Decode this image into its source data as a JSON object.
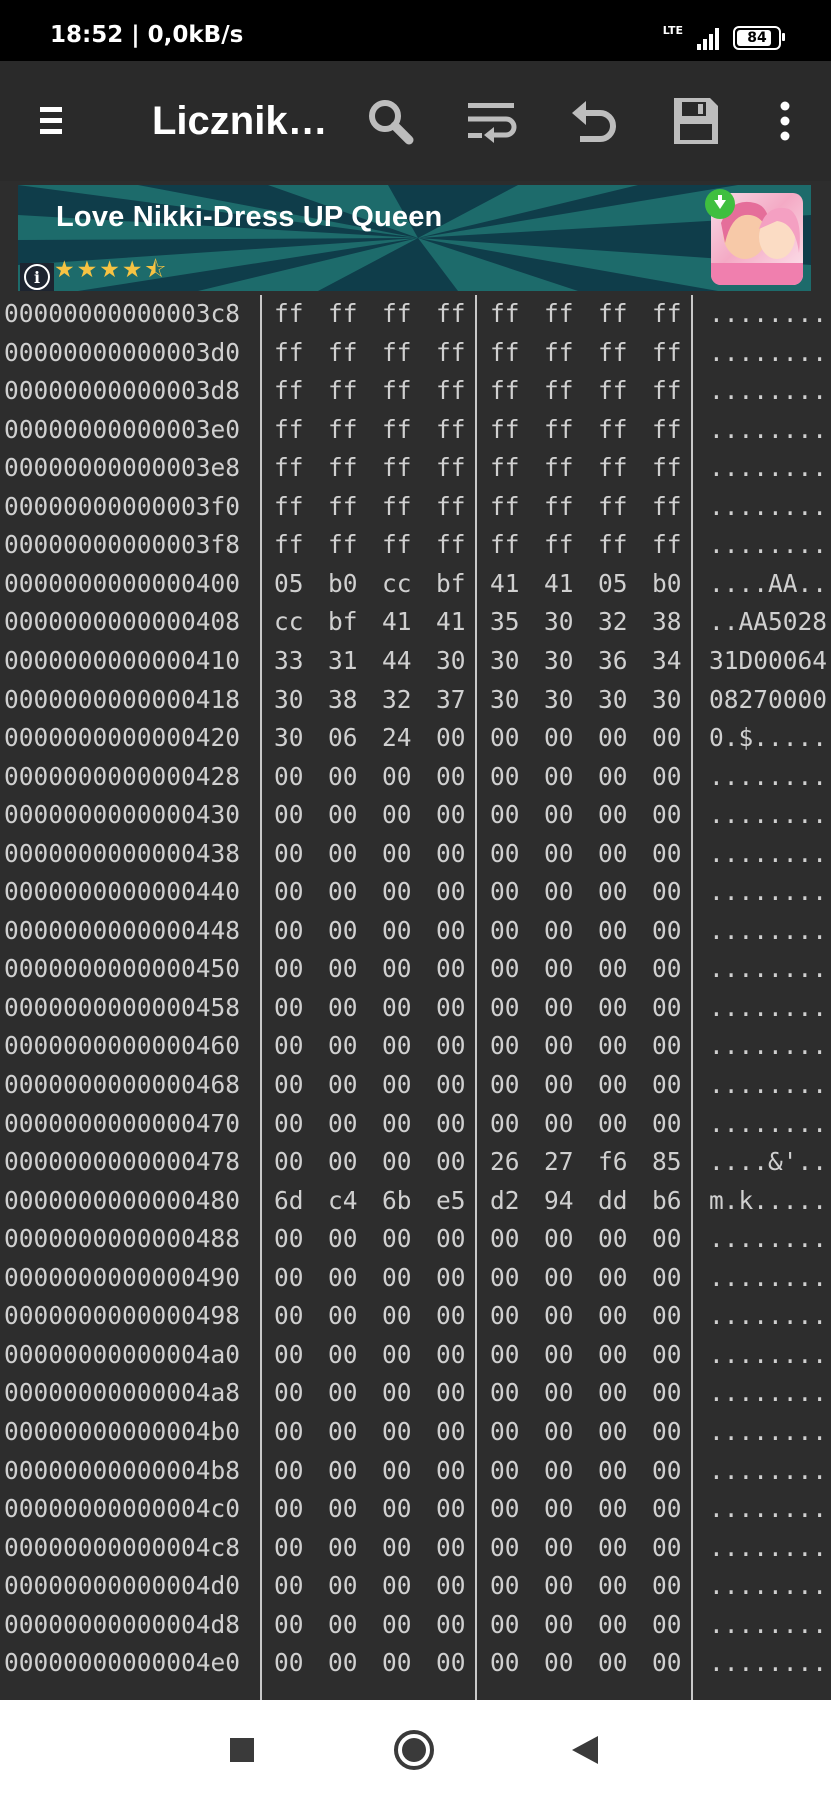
{
  "status_bar": {
    "time_speed": "18:52 | 0,0kB/s",
    "network": "LTE",
    "battery": "84",
    "battery_fraction": 0.84
  },
  "toolbar": {
    "title": "Licznik…",
    "icons": [
      "menu-icon",
      "search-icon",
      "wrap-icon",
      "undo-icon",
      "save-icon",
      "more-vert-icon"
    ]
  },
  "ad": {
    "title": "Love Nikki-Dress UP Queen",
    "stars": "★★★★⯪",
    "rating": 4.5,
    "info_icon": "i"
  },
  "hex_rows": [
    {
      "addr": "00000000000003c8",
      "bytes": [
        "ff",
        "ff",
        "ff",
        "ff",
        "ff",
        "ff",
        "ff",
        "ff"
      ],
      "ascii": "........"
    },
    {
      "addr": "00000000000003d0",
      "bytes": [
        "ff",
        "ff",
        "ff",
        "ff",
        "ff",
        "ff",
        "ff",
        "ff"
      ],
      "ascii": "........"
    },
    {
      "addr": "00000000000003d8",
      "bytes": [
        "ff",
        "ff",
        "ff",
        "ff",
        "ff",
        "ff",
        "ff",
        "ff"
      ],
      "ascii": "........"
    },
    {
      "addr": "00000000000003e0",
      "bytes": [
        "ff",
        "ff",
        "ff",
        "ff",
        "ff",
        "ff",
        "ff",
        "ff"
      ],
      "ascii": "........"
    },
    {
      "addr": "00000000000003e8",
      "bytes": [
        "ff",
        "ff",
        "ff",
        "ff",
        "ff",
        "ff",
        "ff",
        "ff"
      ],
      "ascii": "........"
    },
    {
      "addr": "00000000000003f0",
      "bytes": [
        "ff",
        "ff",
        "ff",
        "ff",
        "ff",
        "ff",
        "ff",
        "ff"
      ],
      "ascii": "........"
    },
    {
      "addr": "00000000000003f8",
      "bytes": [
        "ff",
        "ff",
        "ff",
        "ff",
        "ff",
        "ff",
        "ff",
        "ff"
      ],
      "ascii": "........"
    },
    {
      "addr": "0000000000000400",
      "bytes": [
        "05",
        "b0",
        "cc",
        "bf",
        "41",
        "41",
        "05",
        "b0"
      ],
      "ascii": "....AA.."
    },
    {
      "addr": "0000000000000408",
      "bytes": [
        "cc",
        "bf",
        "41",
        "41",
        "35",
        "30",
        "32",
        "38"
      ],
      "ascii": "..AA5028"
    },
    {
      "addr": "0000000000000410",
      "bytes": [
        "33",
        "31",
        "44",
        "30",
        "30",
        "30",
        "36",
        "34"
      ],
      "ascii": "31D00064"
    },
    {
      "addr": "0000000000000418",
      "bytes": [
        "30",
        "38",
        "32",
        "37",
        "30",
        "30",
        "30",
        "30"
      ],
      "ascii": "08270000"
    },
    {
      "addr": "0000000000000420",
      "bytes": [
        "30",
        "06",
        "24",
        "00",
        "00",
        "00",
        "00",
        "00"
      ],
      "ascii": "0.$....."
    },
    {
      "addr": "0000000000000428",
      "bytes": [
        "00",
        "00",
        "00",
        "00",
        "00",
        "00",
        "00",
        "00"
      ],
      "ascii": "........"
    },
    {
      "addr": "0000000000000430",
      "bytes": [
        "00",
        "00",
        "00",
        "00",
        "00",
        "00",
        "00",
        "00"
      ],
      "ascii": "........"
    },
    {
      "addr": "0000000000000438",
      "bytes": [
        "00",
        "00",
        "00",
        "00",
        "00",
        "00",
        "00",
        "00"
      ],
      "ascii": "........"
    },
    {
      "addr": "0000000000000440",
      "bytes": [
        "00",
        "00",
        "00",
        "00",
        "00",
        "00",
        "00",
        "00"
      ],
      "ascii": "........"
    },
    {
      "addr": "0000000000000448",
      "bytes": [
        "00",
        "00",
        "00",
        "00",
        "00",
        "00",
        "00",
        "00"
      ],
      "ascii": "........"
    },
    {
      "addr": "0000000000000450",
      "bytes": [
        "00",
        "00",
        "00",
        "00",
        "00",
        "00",
        "00",
        "00"
      ],
      "ascii": "........"
    },
    {
      "addr": "0000000000000458",
      "bytes": [
        "00",
        "00",
        "00",
        "00",
        "00",
        "00",
        "00",
        "00"
      ],
      "ascii": "........"
    },
    {
      "addr": "0000000000000460",
      "bytes": [
        "00",
        "00",
        "00",
        "00",
        "00",
        "00",
        "00",
        "00"
      ],
      "ascii": "........"
    },
    {
      "addr": "0000000000000468",
      "bytes": [
        "00",
        "00",
        "00",
        "00",
        "00",
        "00",
        "00",
        "00"
      ],
      "ascii": "........"
    },
    {
      "addr": "0000000000000470",
      "bytes": [
        "00",
        "00",
        "00",
        "00",
        "00",
        "00",
        "00",
        "00"
      ],
      "ascii": "........"
    },
    {
      "addr": "0000000000000478",
      "bytes": [
        "00",
        "00",
        "00",
        "00",
        "26",
        "27",
        "f6",
        "85"
      ],
      "ascii": "....&'.."
    },
    {
      "addr": "0000000000000480",
      "bytes": [
        "6d",
        "c4",
        "6b",
        "e5",
        "d2",
        "94",
        "dd",
        "b6"
      ],
      "ascii": "m.k....."
    },
    {
      "addr": "0000000000000488",
      "bytes": [
        "00",
        "00",
        "00",
        "00",
        "00",
        "00",
        "00",
        "00"
      ],
      "ascii": "........"
    },
    {
      "addr": "0000000000000490",
      "bytes": [
        "00",
        "00",
        "00",
        "00",
        "00",
        "00",
        "00",
        "00"
      ],
      "ascii": "........"
    },
    {
      "addr": "0000000000000498",
      "bytes": [
        "00",
        "00",
        "00",
        "00",
        "00",
        "00",
        "00",
        "00"
      ],
      "ascii": "........"
    },
    {
      "addr": "00000000000004a0",
      "bytes": [
        "00",
        "00",
        "00",
        "00",
        "00",
        "00",
        "00",
        "00"
      ],
      "ascii": "........"
    },
    {
      "addr": "00000000000004a8",
      "bytes": [
        "00",
        "00",
        "00",
        "00",
        "00",
        "00",
        "00",
        "00"
      ],
      "ascii": "........"
    },
    {
      "addr": "00000000000004b0",
      "bytes": [
        "00",
        "00",
        "00",
        "00",
        "00",
        "00",
        "00",
        "00"
      ],
      "ascii": "........"
    },
    {
      "addr": "00000000000004b8",
      "bytes": [
        "00",
        "00",
        "00",
        "00",
        "00",
        "00",
        "00",
        "00"
      ],
      "ascii": "........"
    },
    {
      "addr": "00000000000004c0",
      "bytes": [
        "00",
        "00",
        "00",
        "00",
        "00",
        "00",
        "00",
        "00"
      ],
      "ascii": "........"
    },
    {
      "addr": "00000000000004c8",
      "bytes": [
        "00",
        "00",
        "00",
        "00",
        "00",
        "00",
        "00",
        "00"
      ],
      "ascii": "........"
    },
    {
      "addr": "00000000000004d0",
      "bytes": [
        "00",
        "00",
        "00",
        "00",
        "00",
        "00",
        "00",
        "00"
      ],
      "ascii": "........"
    },
    {
      "addr": "00000000000004d8",
      "bytes": [
        "00",
        "00",
        "00",
        "00",
        "00",
        "00",
        "00",
        "00"
      ],
      "ascii": "........"
    },
    {
      "addr": "00000000000004e0",
      "bytes": [
        "00",
        "00",
        "00",
        "00",
        "00",
        "00",
        "00",
        "00"
      ],
      "ascii": "........"
    }
  ],
  "navbar": {
    "icons": [
      "recent-apps-icon",
      "home-icon",
      "back-icon"
    ]
  },
  "colors": {
    "background": "#2d2d2d",
    "toolbar": "#2a2a2a",
    "text": "#d0d0d0",
    "separator": "#c9c9c9",
    "ad_dark": "#0f3d4a",
    "ad_light": "#1d6b6b"
  }
}
